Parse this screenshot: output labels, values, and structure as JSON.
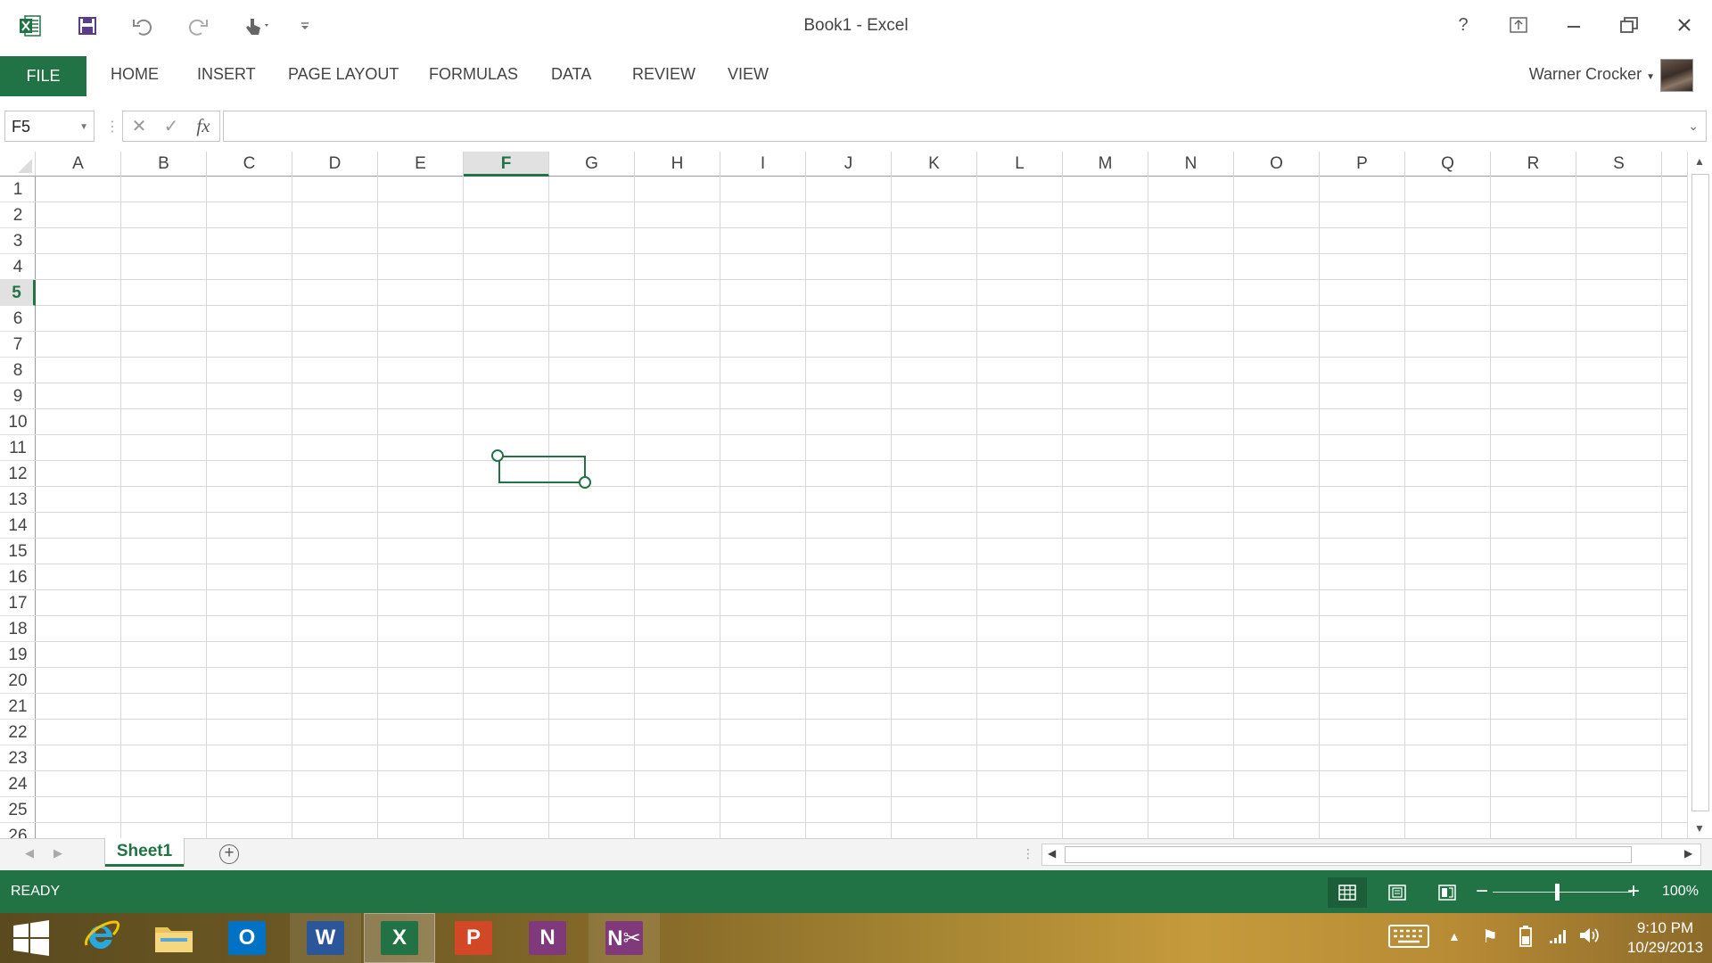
{
  "window": {
    "title": "Book1 - Excel"
  },
  "ribbon": {
    "file_label": "FILE",
    "tabs": [
      "HOME",
      "INSERT",
      "PAGE LAYOUT",
      "FORMULAS",
      "DATA",
      "REVIEW",
      "VIEW"
    ],
    "user_name": "Warner Crocker"
  },
  "formula_bar": {
    "name_box": "F5",
    "fx_label": "fx",
    "formula": ""
  },
  "grid": {
    "columns": [
      "A",
      "B",
      "C",
      "D",
      "E",
      "F",
      "G",
      "H",
      "I",
      "J",
      "K",
      "L",
      "M",
      "N",
      "O",
      "P",
      "Q",
      "R",
      "S"
    ],
    "rows": [
      "1",
      "2",
      "3",
      "4",
      "5",
      "6",
      "7",
      "8",
      "9",
      "10",
      "11",
      "12",
      "13",
      "14",
      "15",
      "16",
      "17",
      "18",
      "19",
      "20",
      "21",
      "22",
      "23",
      "24",
      "25",
      "26"
    ],
    "selected_column": "F",
    "selected_row": "5"
  },
  "sheets": {
    "tabs": [
      "Sheet1"
    ],
    "active": "Sheet1",
    "add_label": "+"
  },
  "status_bar": {
    "status": "READY",
    "zoom": "100%"
  },
  "taskbar": {
    "time": "9:10 PM",
    "date": "10/29/2013",
    "apps": [
      "start",
      "internet-explorer",
      "file-explorer",
      "outlook",
      "word",
      "excel",
      "powerpoint",
      "onenote",
      "onenote-clipper"
    ]
  },
  "colors": {
    "excel_green": "#217346",
    "status_green_dark": "#1b5e39",
    "gridline": "#d9d9d9"
  }
}
